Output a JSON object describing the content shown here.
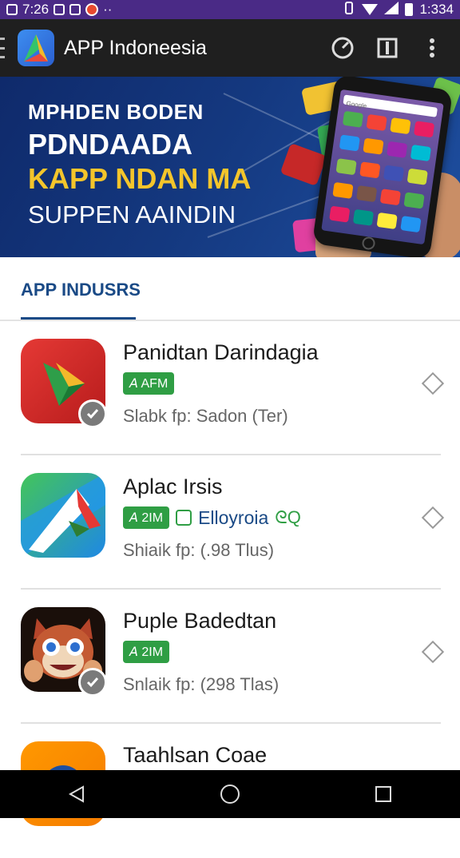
{
  "status_bar": {
    "time": "7:26",
    "right_time": "1:334",
    "dots": "··",
    "colors": {
      "bg": "#4a2a86"
    }
  },
  "app_bar": {
    "title": "APP Indoneesia"
  },
  "banner": {
    "line1": "MPHDEN BODEN",
    "line2": "PDNDAADA",
    "line3": "KAPP NDAN MA",
    "line4": "SUPPEN AAINDIN",
    "phone_search": "Google"
  },
  "tabs": {
    "active": "APP INDUSRS"
  },
  "apps": [
    {
      "title": "Panidtan Darindagia",
      "badge": "𝘈 AFM",
      "subtitle": "Slabk fp: Sadon (Ter)",
      "extra": "",
      "extra_sym": "",
      "has_check": true
    },
    {
      "title": "Aplac Irsis",
      "badge": "𝘈 2IM",
      "subtitle": "Shiaik fp: (.98 Tlus)",
      "extra": "Elloyroia",
      "extra_sym": "ᘓQ",
      "has_check": false
    },
    {
      "title": "Puple Badedtan",
      "badge": "𝘈 2IM",
      "subtitle": "Snlaik fp: (298 Tlas)",
      "extra": "",
      "extra_sym": "",
      "has_check": true
    },
    {
      "title": "Taahlsan Coae",
      "badge": "",
      "subtitle": "",
      "extra": "",
      "extra_sym": "",
      "has_check": false
    }
  ]
}
